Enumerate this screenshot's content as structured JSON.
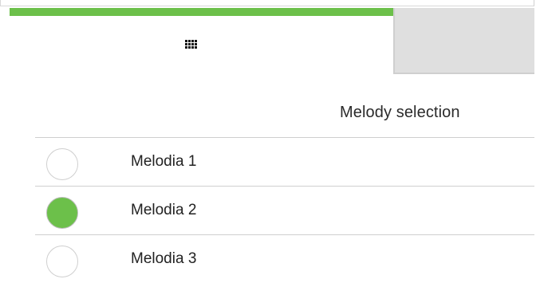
{
  "header": {
    "grid_icon": "grid-icon"
  },
  "main": {
    "title": "Melody selection",
    "options": [
      {
        "label": "Melodia 1",
        "selected": false
      },
      {
        "label": "Melodia 2",
        "selected": true
      },
      {
        "label": "Melodia 3",
        "selected": false
      }
    ]
  },
  "colors": {
    "accent": "#6cc04a",
    "tab_inactive": "#dfdfdf",
    "divider": "#cfcfcf"
  }
}
